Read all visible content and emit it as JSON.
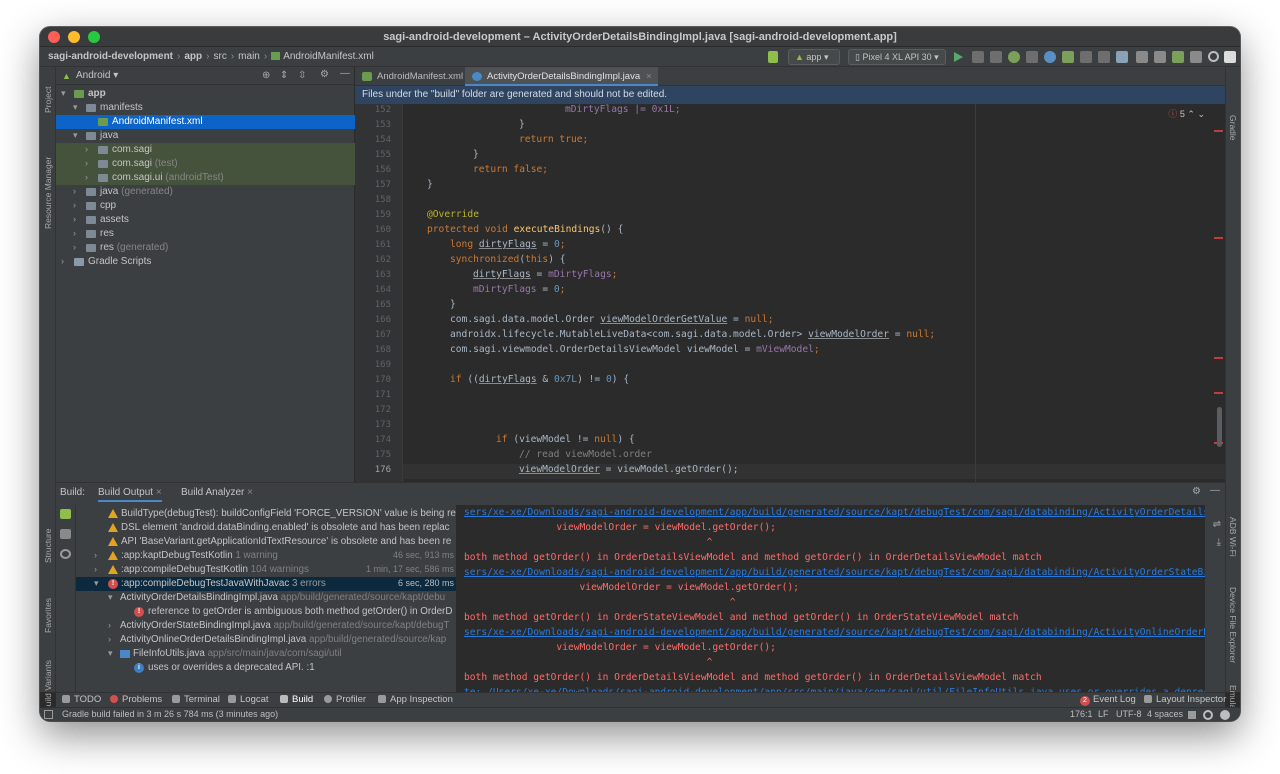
{
  "window": {
    "title": "sagi-android-development – ActivityOrderDetailsBindingImpl.java [sagi-android-development.app]"
  },
  "breadcrumb": [
    "sagi-android-development",
    "app",
    "src",
    "main",
    "AndroidManifest.xml"
  ],
  "toolbar": {
    "run_config": "app",
    "device": "Pixel 4 XL API 30"
  },
  "left_strip": {
    "project": "Project",
    "resource_manager": "Resource Manager",
    "structure": "Structure",
    "favorites": "Favorites",
    "build_variants": "Build Variants"
  },
  "right_strip": {
    "gradle": "Gradle",
    "adb_wifi": "ADB Wi-Fi",
    "device_file_explorer": "Device File Explorer",
    "emulator": "Emulator"
  },
  "project": {
    "view": "Android",
    "tree": [
      {
        "label": "app",
        "suffix": ""
      },
      {
        "label": "manifests",
        "suffix": ""
      },
      {
        "label": "AndroidManifest.xml",
        "suffix": ""
      },
      {
        "label": "java",
        "suffix": ""
      },
      {
        "label": "com.sagi",
        "suffix": ""
      },
      {
        "label": "com.sagi",
        "suffix": "(test)"
      },
      {
        "label": "com.sagi.ui",
        "suffix": "(androidTest)"
      },
      {
        "label": "java",
        "suffix": "(generated)"
      },
      {
        "label": "cpp",
        "suffix": ""
      },
      {
        "label": "assets",
        "suffix": ""
      },
      {
        "label": "res",
        "suffix": ""
      },
      {
        "label": "res",
        "suffix": "(generated)"
      },
      {
        "label": "Gradle Scripts",
        "suffix": ""
      }
    ]
  },
  "editor": {
    "tabs": [
      {
        "label": "AndroidManifest.xml"
      },
      {
        "label": "ActivityOrderDetailsBindingImpl.java"
      }
    ],
    "banner": "Files under the \"build\" folder are generated and should not be edited.",
    "error_count": "5",
    "line_numbers": [
      "152",
      "153",
      "154",
      "155",
      "156",
      "157",
      "158",
      "159",
      "160",
      "161",
      "162",
      "163",
      "164",
      "165",
      "166",
      "167",
      "168",
      "169",
      "170",
      "171",
      "172",
      "173",
      "174",
      "175",
      "176"
    ],
    "code": {
      "l152": "mDirtyFlags |= 0x1L;",
      "l153": "}",
      "l154": "return true;",
      "l155": "}",
      "l156": "return false;",
      "l157": "}",
      "l159": "@Override",
      "l160a": "protected void ",
      "l160b": "executeBindings",
      "l160c": "() {",
      "l161a": "long ",
      "l161b": "dirtyFlags",
      "l161c": " = ",
      "l161d": "0",
      "l161e": ";",
      "l162a": "synchronized",
      "l162b": "(",
      "l162c": "this",
      "l162d": ") {",
      "l163a": "dirtyFlags",
      "l163b": " = ",
      "l163c": "mDirtyFlags",
      "l163d": ";",
      "l164a": "mDirtyFlags",
      "l164b": " = ",
      "l164c": "0",
      "l164d": ";",
      "l165": "}",
      "l166a": "com.sagi.data.model.Order ",
      "l166b": "viewModelOrderGetValue",
      "l166c": " = ",
      "l166d": "null",
      "l166e": ";",
      "l167a": "androidx.lifecycle.MutableLiveData<com.sagi.data.model.Order> ",
      "l167b": "viewModelOrder",
      "l167c": " = ",
      "l167d": "null",
      "l167e": ";",
      "l168a": "com.sagi.viewmodel.OrderDetailsViewModel viewModel = ",
      "l168b": "mViewModel",
      "l168c": ";",
      "l170a": "if ",
      "l170b": "((",
      "l170c": "dirtyFlags",
      "l170d": " & ",
      "l170e": "0x7L",
      "l170f": ") != ",
      "l170g": "0",
      "l170h": ") {",
      "l174a": "if ",
      "l174b": "(viewModel != ",
      "l174c": "null",
      "l174d": ") {",
      "l175": "// read viewModel.order",
      "l176a": "viewModelOrder",
      "l176b": " = viewModel.getOrder();"
    }
  },
  "build": {
    "label": "Build:",
    "tabs": [
      "Build Output",
      "Build Analyzer"
    ],
    "tree": [
      {
        "text": "BuildType(debugTest): buildConfigField 'FORCE_VERSION' value is being re",
        "time": ""
      },
      {
        "text": "DSL element 'android.dataBinding.enabled' is obsolete and has been replac",
        "time": ""
      },
      {
        "text": "API 'BaseVariant.getApplicationIdTextResource' is obsolete and has been re",
        "time": ""
      },
      {
        "text": ":app:kaptDebugTestKotlin",
        "suffix": "1 warning",
        "time": "46 sec, 913 ms"
      },
      {
        "text": ":app:compileDebugTestKotlin",
        "suffix": "104 warnings",
        "time": "1 min, 17 sec, 586 ms"
      },
      {
        "text": ":app:compileDebugTestJavaWithJavac",
        "suffix": "3 errors",
        "time": "6 sec, 280 ms"
      },
      {
        "text": "ActivityOrderDetailsBindingImpl.java",
        "suffix": "app/build/generated/source/kapt/debu",
        "time": ""
      },
      {
        "text": "reference to getOrder is ambiguous both method getOrder() in OrderD",
        "time": ""
      },
      {
        "text": "ActivityOrderStateBindingImpl.java",
        "suffix": "app/build/generated/source/kapt/debugT",
        "time": ""
      },
      {
        "text": "ActivityOnlineOrderDetailsBindingImpl.java",
        "suffix": "app/build/generated/source/kap",
        "time": ""
      },
      {
        "text": "FileInfoUtils.java",
        "suffix": "app/src/main/java/com/sagi/util",
        "time": ""
      },
      {
        "text": "uses or overrides a deprecated API. :1",
        "time": ""
      }
    ],
    "output": [
      {
        "kind": "link",
        "text": "sers/xe-xe/Downloads/sagi-android-development/app/build/generated/source/kapt/debugTest/com/sagi/databinding/ActivityOrderDetailsBi"
      },
      {
        "kind": "err",
        "text": "                viewModelOrder = viewModel.getOrder();"
      },
      {
        "kind": "err",
        "text": "                                          ^"
      },
      {
        "kind": "err",
        "text": "both method getOrder() in OrderDetailsViewModel and method getOrder() in OrderDetailsViewModel match"
      },
      {
        "kind": "link",
        "text": "sers/xe-xe/Downloads/sagi-android-development/app/build/generated/source/kapt/debugTest/com/sagi/databinding/ActivityOrderStateBin"
      },
      {
        "kind": "err",
        "text": "                    viewModelOrder = viewModel.getOrder();"
      },
      {
        "kind": "err",
        "text": "                                              ^"
      },
      {
        "kind": "err",
        "text": "both method getOrder() in OrderStateViewModel and method getOrder() in OrderStateViewModel match"
      },
      {
        "kind": "link",
        "text": "sers/xe-xe/Downloads/sagi-android-development/app/build/generated/source/kapt/debugTest/com/sagi/databinding/ActivityOnlineOrderDe"
      },
      {
        "kind": "err",
        "text": "                viewModelOrder = viewModel.getOrder();"
      },
      {
        "kind": "err",
        "text": "                                          ^"
      },
      {
        "kind": "err",
        "text": "both method getOrder() in OrderDetailsViewModel and method getOrder() in OrderDetailsViewModel match"
      },
      {
        "kind": "link",
        "text": "te: /Users/xe-xe/Downloads/sagi-android-development/app/src/main/java/com/sagi/util/FileInfoUtils.java uses or overrides a deprecat"
      }
    ]
  },
  "toolwindows": [
    "TODO",
    "Problems",
    "Terminal",
    "Logcat",
    "Build",
    "Profiler",
    "App Inspection"
  ],
  "toolwindows_right": {
    "event_log": "Event Log",
    "event_count": "2",
    "layout_inspector": "Layout Inspector"
  },
  "status": {
    "message": "Gradle build failed in 3 m 26 s 784 ms (3 minutes ago)",
    "position": "176:1",
    "line_sep": "LF",
    "encoding": "UTF-8",
    "indent": "4 spaces"
  }
}
